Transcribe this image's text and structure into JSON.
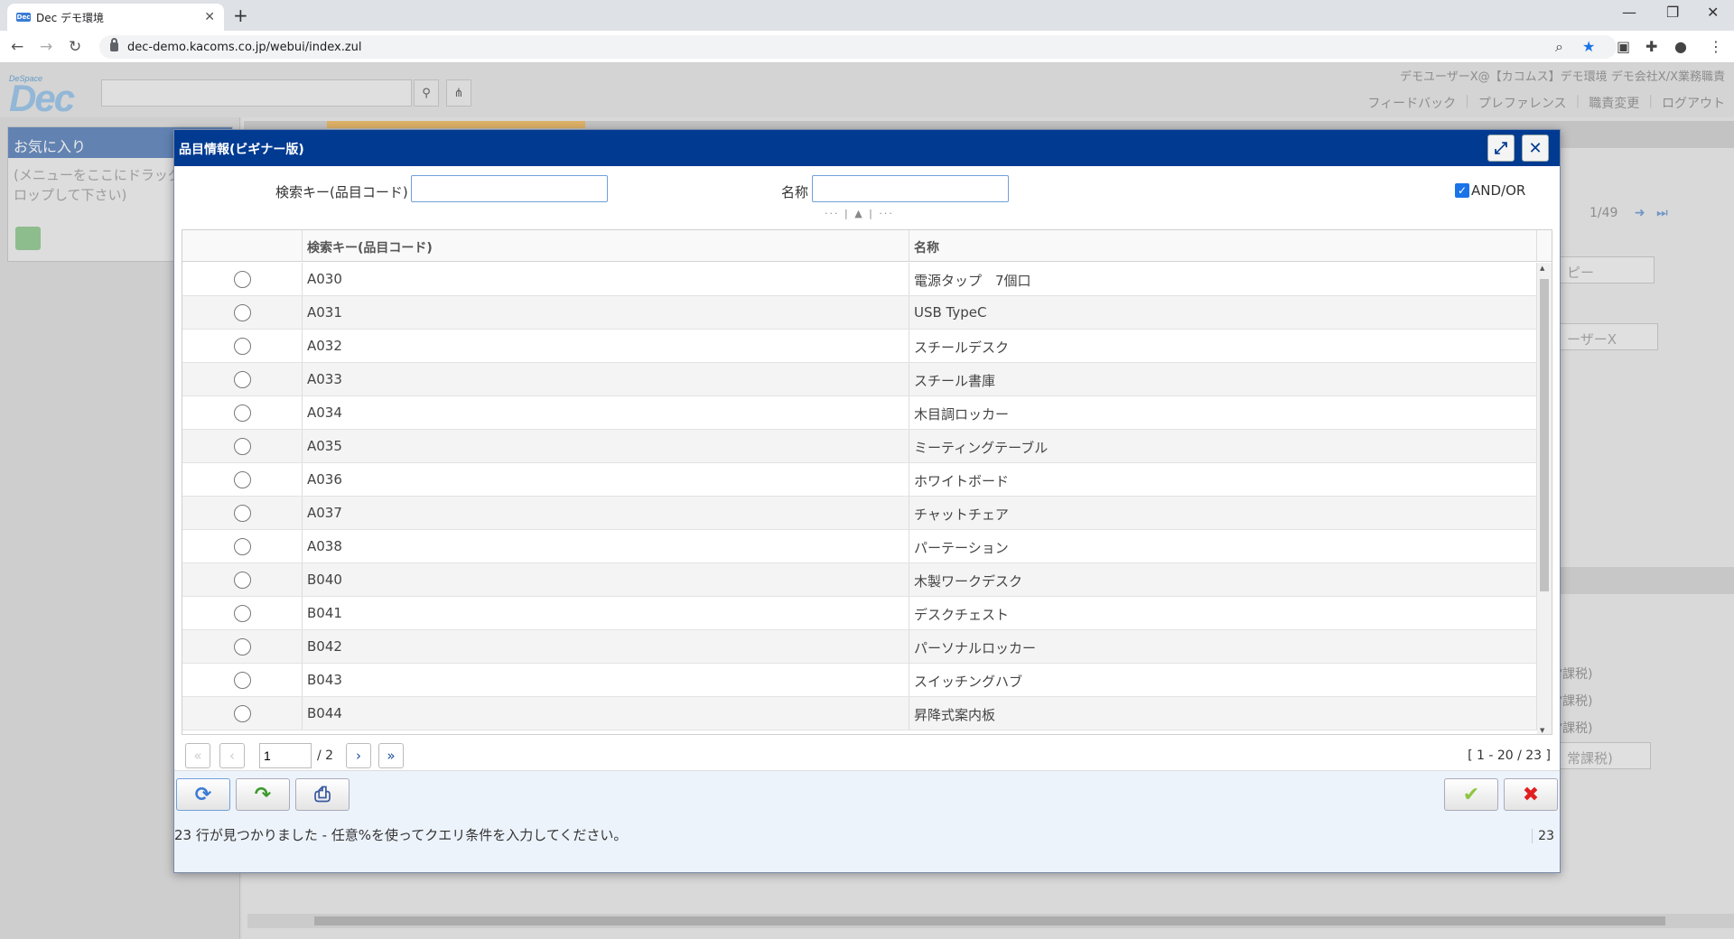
{
  "browser": {
    "tab_title": "Dec デモ環境",
    "url": "dec-demo.kacoms.co.jp/webui/index.zul"
  },
  "app": {
    "logo_small": "DeSpace",
    "logo_big": "Dec",
    "user_info": "デモユーザーX@【カコムス】デモ環境 デモ会社X/X業務職責",
    "links": [
      "フィードバック",
      "プレファレンス",
      "職責変更",
      "ログアウト"
    ],
    "favorites": {
      "title": "お気に入り",
      "hint": "(メニューをここにドラッグ&ドロップして下さい)",
      "hint_line1": "(メニューをここにドラッグ",
      "hint_line2": "ロップして下さい)"
    },
    "background": {
      "pager": "1/49",
      "field1": "ピー",
      "field2": "ーザーX",
      "row1": "常課税)",
      "row2": "常課税)",
      "row3": "常課税)",
      "row4": "常課税)"
    }
  },
  "dialog": {
    "title": "品目情報(ビギナー版)",
    "filters": {
      "key_label": "検索キー(品目コード)",
      "key_value": "",
      "name_label": "名称",
      "name_value": "",
      "andor_label": "AND/OR",
      "andor_checked": true
    },
    "columns": [
      "",
      "検索キー(品目コード)",
      "名称"
    ],
    "rows": [
      {
        "code": "A030",
        "name": "電源タップ　7個口"
      },
      {
        "code": "A031",
        "name": "USB TypeC"
      },
      {
        "code": "A032",
        "name": "スチールデスク"
      },
      {
        "code": "A033",
        "name": "スチール書庫"
      },
      {
        "code": "A034",
        "name": "木目調ロッカー"
      },
      {
        "code": "A035",
        "name": "ミーティングテーブル"
      },
      {
        "code": "A036",
        "name": "ホワイトボード"
      },
      {
        "code": "A037",
        "name": "チャットチェア"
      },
      {
        "code": "A038",
        "name": "パーテーション"
      },
      {
        "code": "B040",
        "name": "木製ワークデスク"
      },
      {
        "code": "B041",
        "name": "デスクチェスト"
      },
      {
        "code": "B042",
        "name": "パーソナルロッカー"
      },
      {
        "code": "B043",
        "name": "スイッチングハブ"
      },
      {
        "code": "B044",
        "name": "昇降式案内板"
      }
    ],
    "pager": {
      "page": "1",
      "total": "/ 2",
      "range": "[ 1 - 20 / 23 ]"
    },
    "footer": {
      "status": "23 行が見つかりました - 任意%を使ってクエリ条件を入力してください。",
      "count": "23"
    }
  },
  "colors": {
    "dialog_title_bg": "#003a91",
    "accent": "#1a73e8",
    "ok_check": "#8cc63f",
    "cancel_x": "#e02020"
  }
}
